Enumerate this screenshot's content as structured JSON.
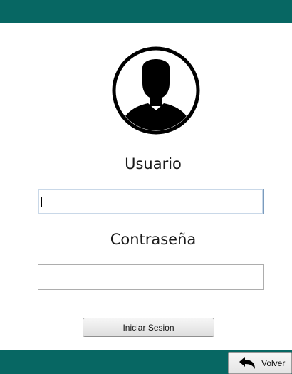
{
  "form": {
    "user_label": "Usuario",
    "user_value": "",
    "password_label": "Contraseña",
    "password_value": ""
  },
  "buttons": {
    "login_label": "Iniciar Sesion",
    "back_label": "Volver",
    "back_icon": "back-arrow-icon"
  },
  "avatar": {
    "icon": "user-silhouette-icon"
  },
  "colors": {
    "bars": "#076763"
  }
}
